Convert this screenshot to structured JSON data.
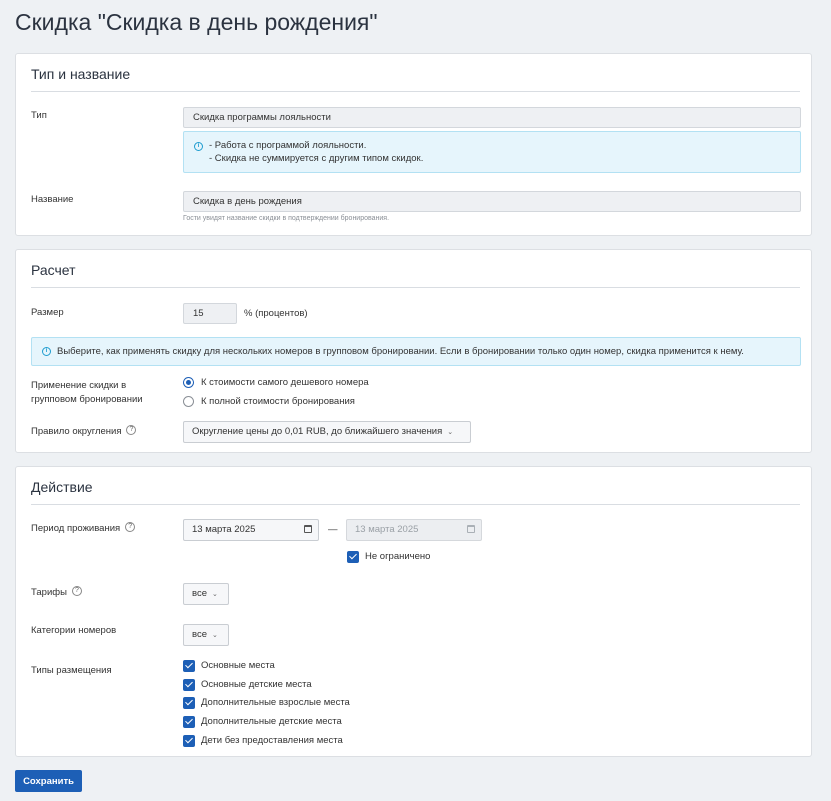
{
  "page": {
    "title": "Скидка \"Скидка в день рождения\""
  },
  "section_type": {
    "title": "Тип и название",
    "type_label": "Тип",
    "type_value": "Скидка программы лояльности",
    "info_line1": "- Работа с программой лояльности.",
    "info_line2": "- Скидка не суммируется с другим типом скидок.",
    "name_label": "Название",
    "name_value": "Скидка в день рождения",
    "name_hint": "Гости увидят название скидки в подтверждении бронирования."
  },
  "section_calc": {
    "title": "Расчет",
    "size_label": "Размер",
    "size_value": "15",
    "size_unit": "% (процентов)",
    "info_text": "Выберите, как применять скидку для нескольких номеров в групповом бронировании. Если в бронировании только один номер, скидка применится к нему.",
    "group_label_line1": "Применение скидки в",
    "group_label_line2": "групповом бронировании",
    "options": [
      {
        "label": "К стоимости самого дешевого номера",
        "selected": true
      },
      {
        "label": "К полной стоимости бронирования",
        "selected": false
      }
    ],
    "rounding_label": "Правило округления",
    "rounding_value": "Округление цены до 0,01 RUB, до ближайшего значения"
  },
  "section_action": {
    "title": "Действие",
    "period_label": "Период проживания",
    "date_from": "13 марта 2025",
    "date_sep": "—",
    "date_to": "13 марта 2025",
    "unlimited_label": "Не ограничено",
    "unlimited_checked": true,
    "tariffs_label": "Тарифы",
    "tariffs_value": "все",
    "categories_label": "Категории номеров",
    "categories_value": "все",
    "placement_label": "Типы размещения",
    "placements": [
      {
        "label": "Основные места",
        "checked": true
      },
      {
        "label": "Основные детские места",
        "checked": true
      },
      {
        "label": "Дополнительные взрослые места",
        "checked": true
      },
      {
        "label": "Дополнительные детские места",
        "checked": true
      },
      {
        "label": "Дети без предоставления места",
        "checked": true
      }
    ]
  },
  "footer": {
    "save_label": "Сохранить"
  },
  "icons": {
    "info": "info-icon",
    "help": "question-circle-icon",
    "calendar": "calendar-icon",
    "chevron": "chevron-down-icon",
    "check": "check-icon"
  },
  "colors": {
    "primary": "#1d5fb6",
    "info_bg": "#e6f5fc",
    "info_border": "#b3e1f3",
    "page_bg": "#eef1f4"
  }
}
